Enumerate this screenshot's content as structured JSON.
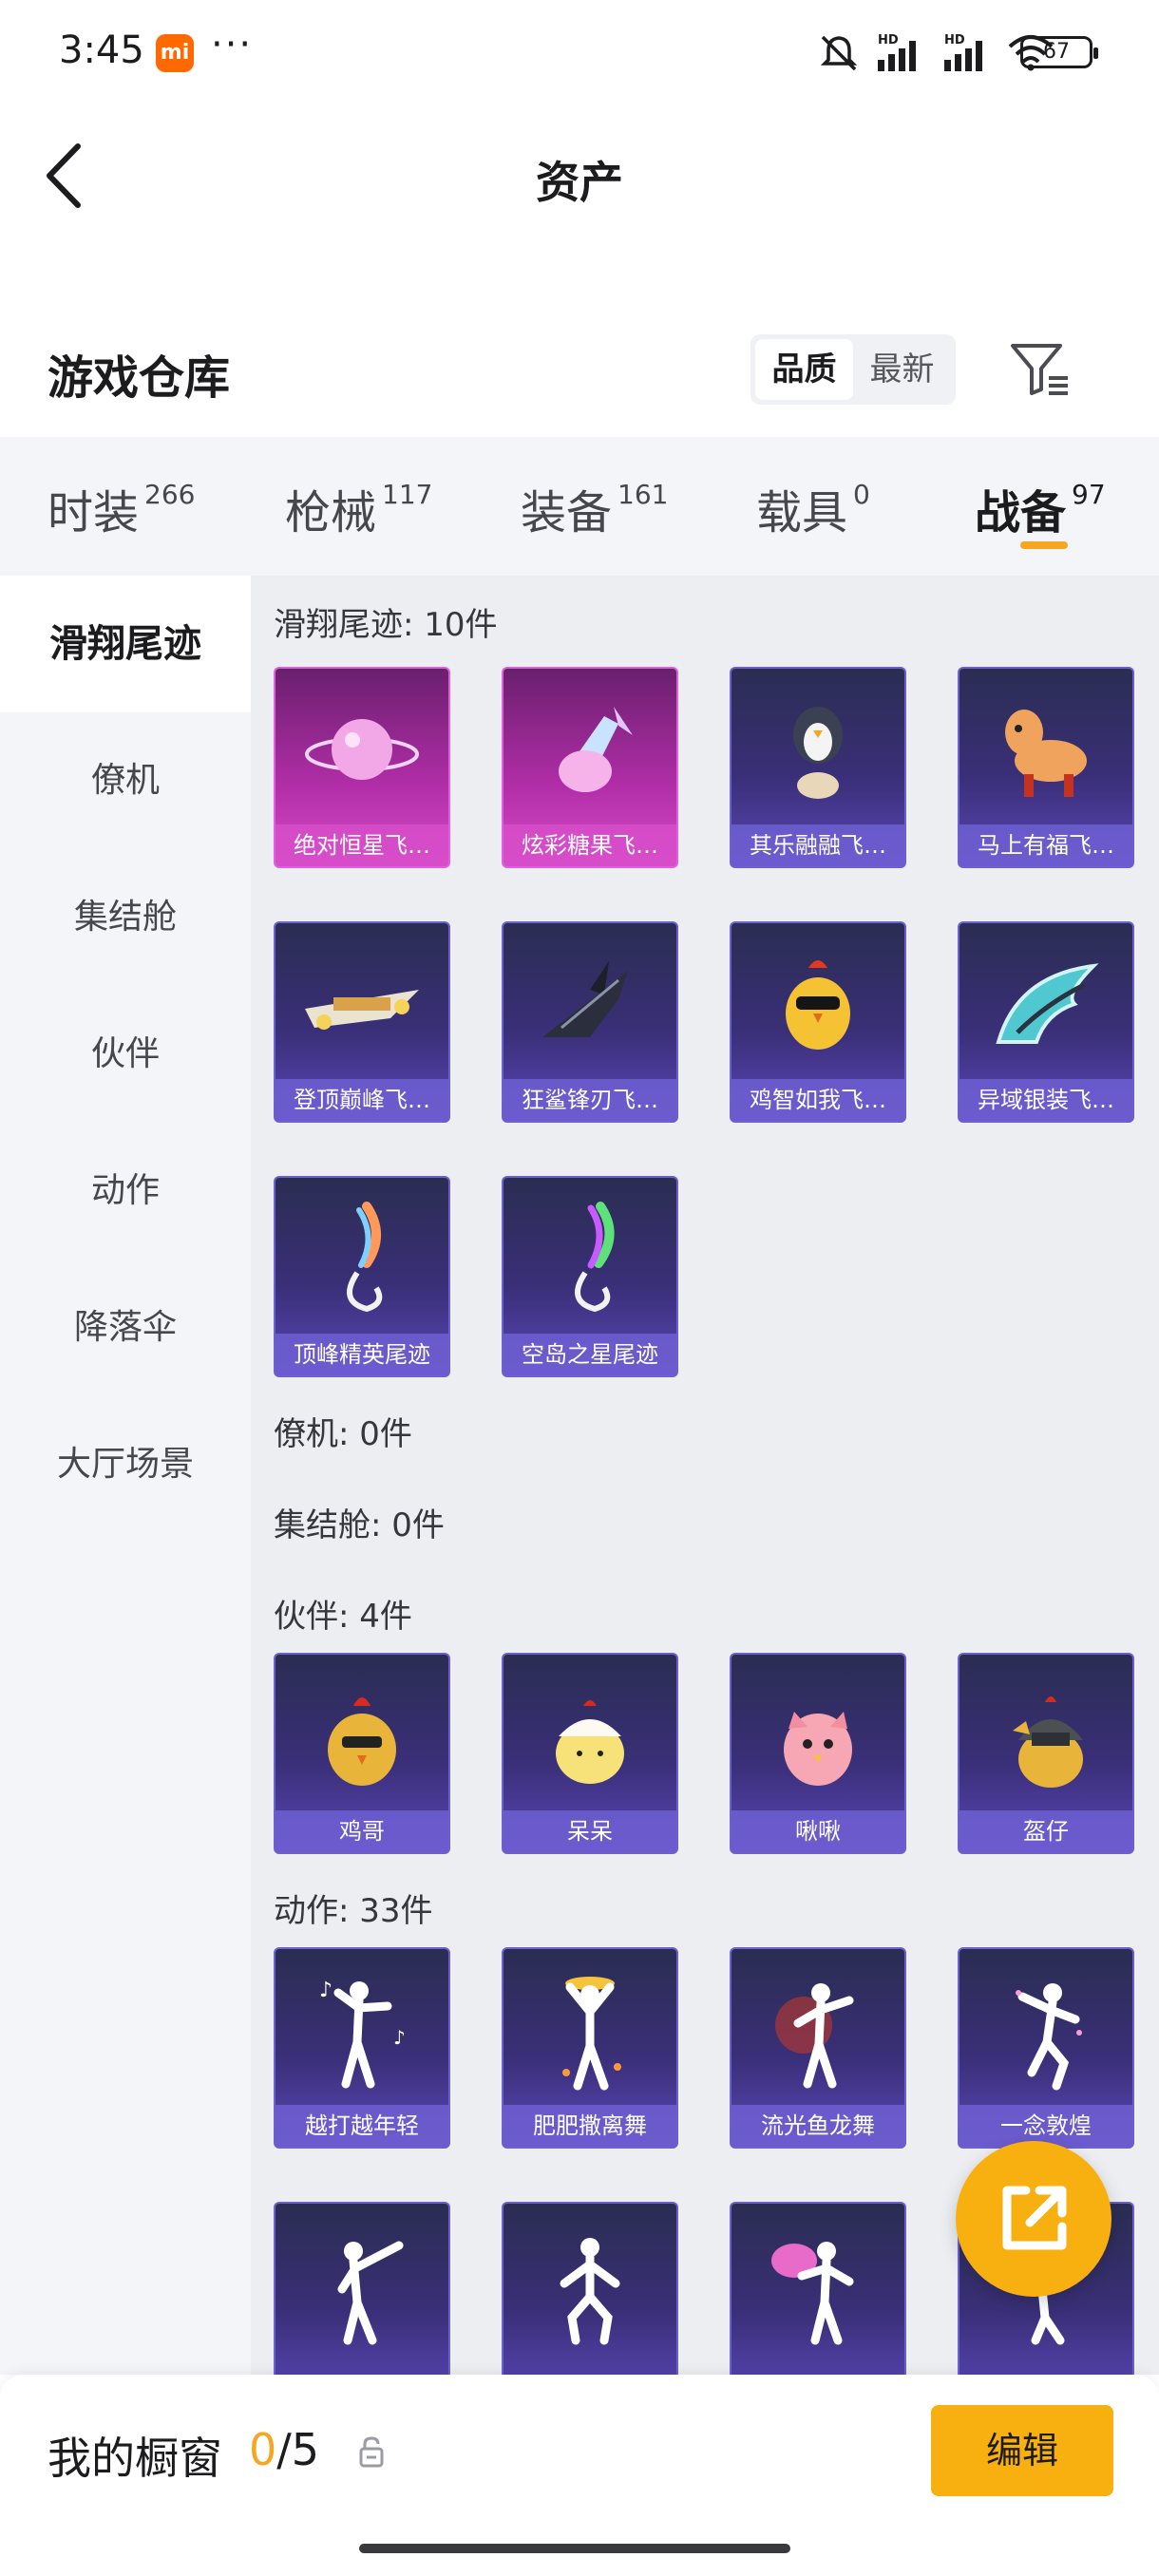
{
  "status_bar": {
    "time": "3:45",
    "app_badge": "mi",
    "dots": "···",
    "battery": "67"
  },
  "header": {
    "title": "资产"
  },
  "warehouse": {
    "title": "游戏仓库",
    "sort_options": [
      "品质",
      "最新"
    ],
    "active_sort": "品质"
  },
  "tabs": [
    {
      "label": "时装",
      "count": "266"
    },
    {
      "label": "枪械",
      "count": "117"
    },
    {
      "label": "装备",
      "count": "161"
    },
    {
      "label": "载具",
      "count": "0"
    },
    {
      "label": "战备",
      "count": "97"
    }
  ],
  "active_tab": "战备",
  "sidebar": [
    {
      "label": "滑翔尾迹"
    },
    {
      "label": "僚机"
    },
    {
      "label": "集结舱"
    },
    {
      "label": "伙伴"
    },
    {
      "label": "动作"
    },
    {
      "label": "降落伞"
    },
    {
      "label": "大厅场景"
    }
  ],
  "sections": {
    "glide": {
      "title": "滑翔尾迹: 10件",
      "items": [
        "绝对恒星飞…",
        "炫彩糖果飞…",
        "其乐融融飞…",
        "马上有福飞…",
        "登顶巅峰飞…",
        "狂鲨锋刃飞…",
        "鸡智如我飞…",
        "异域银装飞…",
        "顶峰精英尾迹",
        "空岛之星尾迹"
      ]
    },
    "wingman": {
      "title": "僚机: 0件"
    },
    "pod": {
      "title": "集结舱: 0件"
    },
    "partner": {
      "title": "伙伴: 4件",
      "items": [
        "鸡哥",
        "呆呆",
        "啾啾",
        "盔仔"
      ]
    },
    "emote": {
      "title": "动作: 33件",
      "items": [
        "越打越年轻",
        "肥肥撒离舞",
        "流光鱼龙舞",
        "一念敦煌"
      ]
    }
  },
  "bottom": {
    "label": "我的橱窗",
    "used": "0",
    "total": "/5",
    "edit": "编辑"
  },
  "colors": {
    "accent": "#f7b00f",
    "underline": "#f5a623",
    "legendary": "#d64cc9",
    "epic": "#5a47b8"
  }
}
